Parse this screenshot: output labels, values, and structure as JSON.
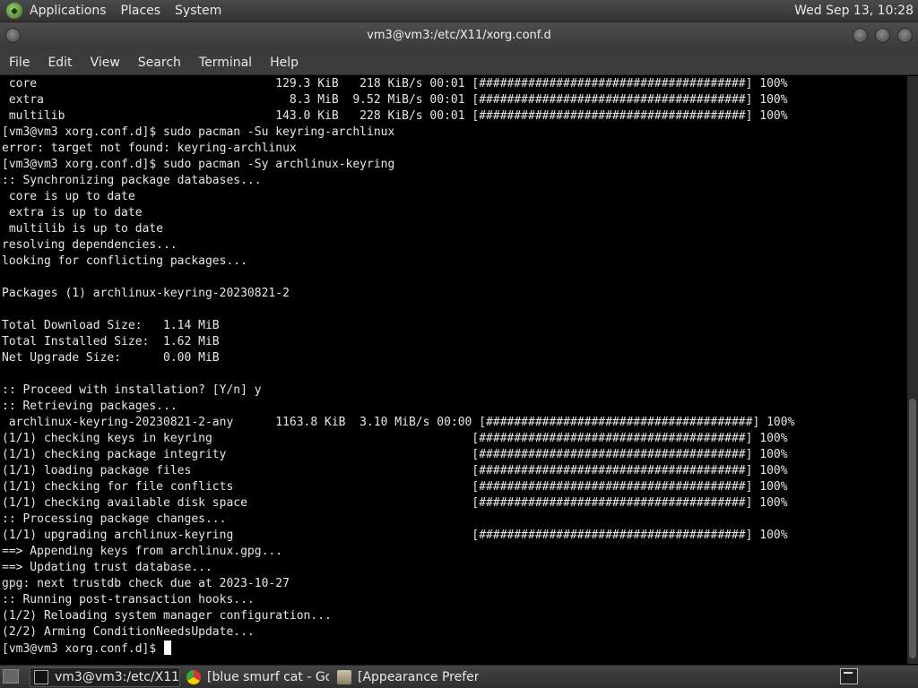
{
  "top_panel": {
    "menus": [
      "Applications",
      "Places",
      "System"
    ],
    "clock": "Wed Sep 13, 10:28"
  },
  "window": {
    "title": "vm3@vm3:/etc/X11/xorg.conf.d"
  },
  "menubar": [
    "File",
    "Edit",
    "View",
    "Search",
    "Terminal",
    "Help"
  ],
  "terminal": {
    "lines": [
      " core                                  129.3 KiB   218 KiB/s 00:01 [######################################] 100%",
      " extra                                   8.3 MiB  9.52 MiB/s 00:01 [######################################] 100%",
      " multilib                              143.0 KiB   228 KiB/s 00:01 [######################################] 100%",
      "[vm3@vm3 xorg.conf.d]$ sudo pacman -Su keyring-archlinux",
      "error: target not found: keyring-archlinux",
      "[vm3@vm3 xorg.conf.d]$ sudo pacman -Sy archlinux-keyring",
      ":: Synchronizing package databases...",
      " core is up to date",
      " extra is up to date",
      " multilib is up to date",
      "resolving dependencies...",
      "looking for conflicting packages...",
      "",
      "Packages (1) archlinux-keyring-20230821-2",
      "",
      "Total Download Size:   1.14 MiB",
      "Total Installed Size:  1.62 MiB",
      "Net Upgrade Size:      0.00 MiB",
      "",
      ":: Proceed with installation? [Y/n] y",
      ":: Retrieving packages...",
      " archlinux-keyring-20230821-2-any      1163.8 KiB  3.10 MiB/s 00:00 [######################################] 100%",
      "(1/1) checking keys in keyring                                     [######################################] 100%",
      "(1/1) checking package integrity                                   [######################################] 100%",
      "(1/1) loading package files                                        [######################################] 100%",
      "(1/1) checking for file conflicts                                  [######################################] 100%",
      "(1/1) checking available disk space                                [######################################] 100%",
      ":: Processing package changes...",
      "(1/1) upgrading archlinux-keyring                                  [######################################] 100%",
      "==> Appending keys from archlinux.gpg...",
      "==> Updating trust database...",
      "gpg: next trustdb check due at 2023-10-27",
      ":: Running post-transaction hooks...",
      "(1/2) Reloading system manager configuration...",
      "(2/2) Arming ConditionNeedsUpdate...",
      "[vm3@vm3 xorg.conf.d]$ "
    ]
  },
  "taskbar": {
    "tasks": [
      {
        "label": "vm3@vm3:/etc/X11/...",
        "icon": "terminal-icon",
        "active": true
      },
      {
        "label": "[blue smurf cat - Go...",
        "icon": "chrome-icon",
        "active": false
      },
      {
        "label": "[Appearance Prefer...",
        "icon": "appearance-icon",
        "active": false
      }
    ]
  }
}
